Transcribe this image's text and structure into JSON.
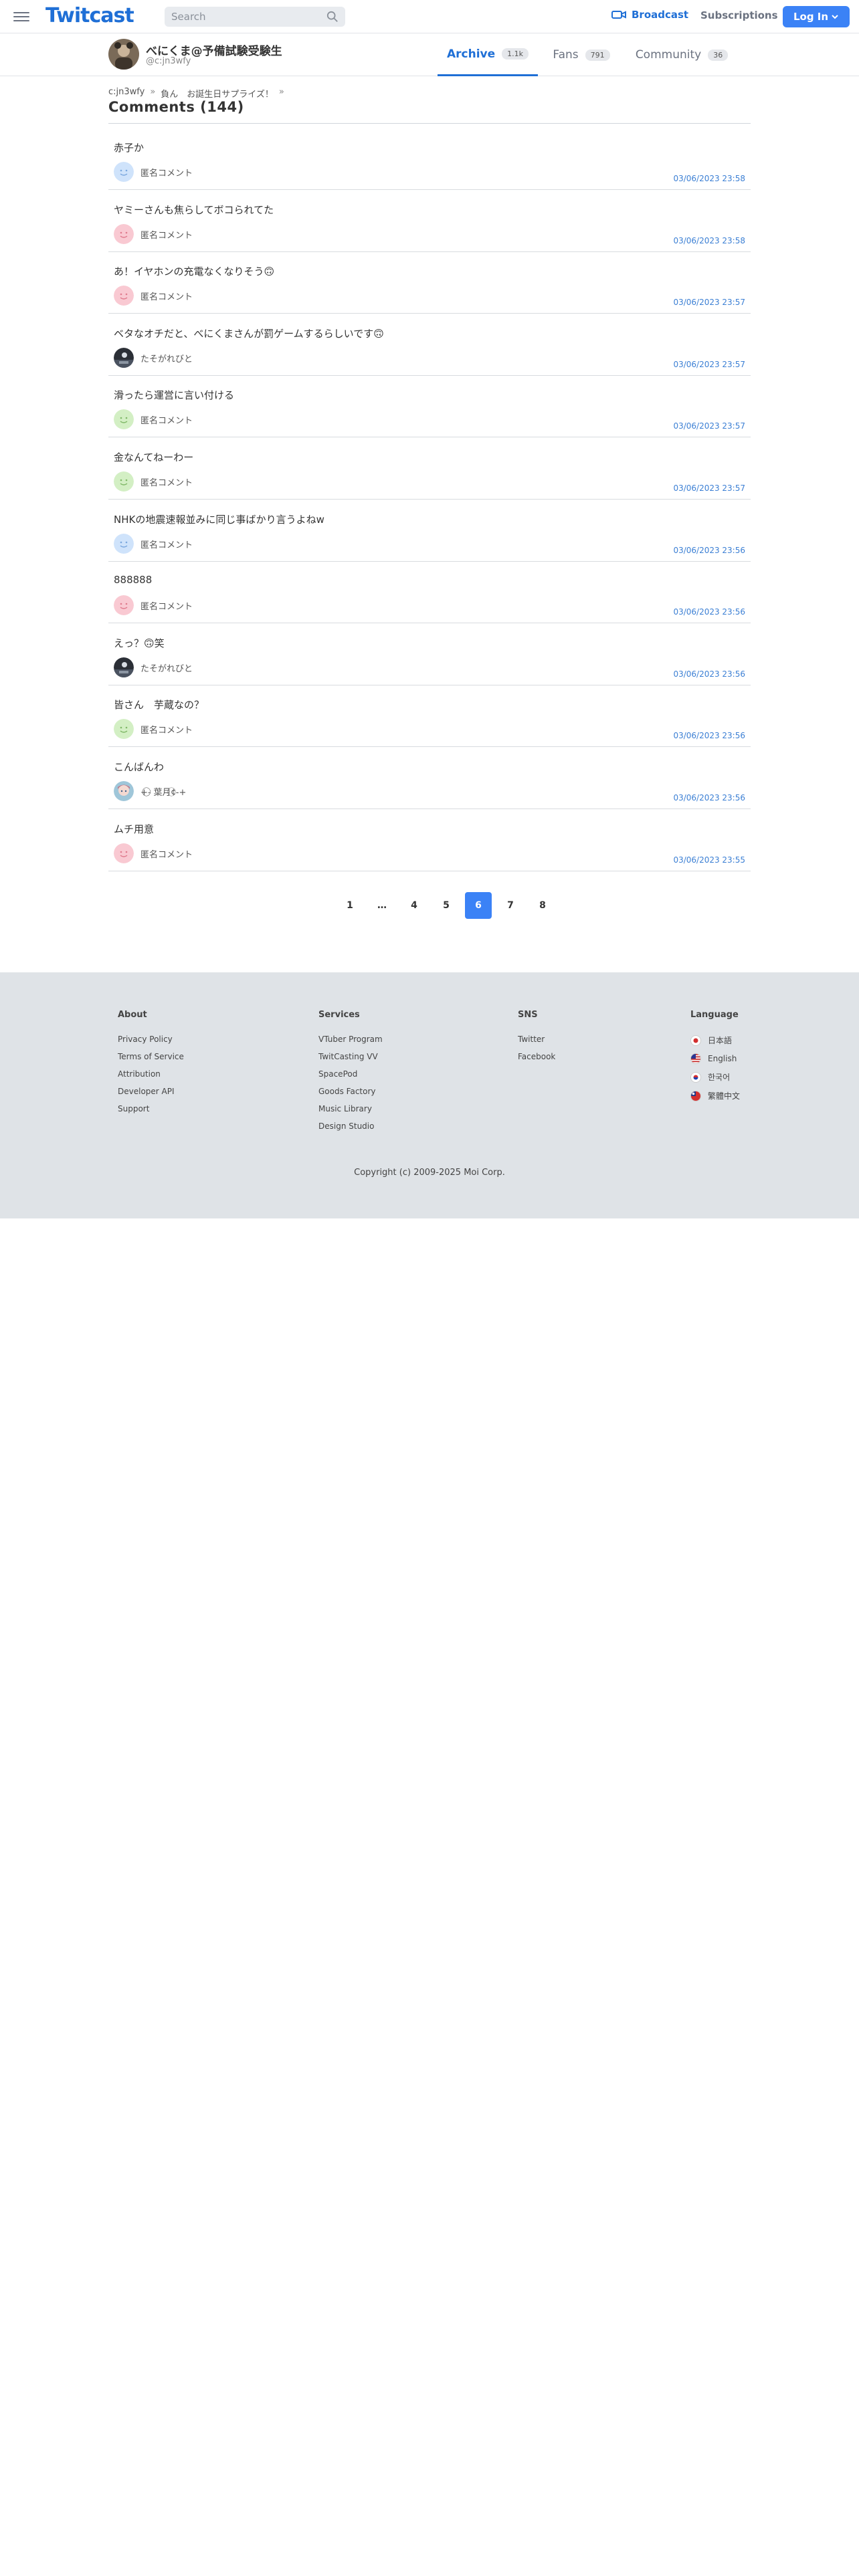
{
  "header": {
    "logo": "Twitcast",
    "search_placeholder": "Search",
    "broadcast_label": "Broadcast",
    "subscriptions_label": "Subscriptions",
    "login_label": "Log In"
  },
  "profile": {
    "name": "べにくま@予備試験受験生",
    "id": "@c:jn3wfy",
    "tabs": [
      {
        "label": "Archive",
        "count": "1.1k"
      },
      {
        "label": "Fans",
        "count": "791"
      },
      {
        "label": "Community",
        "count": "36"
      }
    ]
  },
  "breadcrumb": {
    "item0": "c:jn3wfy",
    "item1": "負ん　お誕生日サプライズ！",
    "sep": "»"
  },
  "page_title": "Comments (144)",
  "comments": [
    {
      "text": "赤子か",
      "user": "匿名コメント",
      "time": "03/06/2023 23:58",
      "avatar": "anon-blue"
    },
    {
      "text": "ヤミーさんも焦らしてボコられてた",
      "user": "匿名コメント",
      "time": "03/06/2023 23:58",
      "avatar": "anon-pink"
    },
    {
      "text": "あ！イヤホンの充電なくなりそう🙃",
      "user": "匿名コメント",
      "time": "03/06/2023 23:57",
      "avatar": "anon-pink"
    },
    {
      "text": "ベタなオチだと、べにくまさんが罰ゲームするらしいです🙃",
      "user": "たそがれびと",
      "time": "03/06/2023 23:57",
      "avatar": "photo-dark"
    },
    {
      "text": "滑ったら運営に言い付ける",
      "user": "匿名コメント",
      "time": "03/06/2023 23:57",
      "avatar": "anon-green"
    },
    {
      "text": "金なんてねーわー",
      "user": "匿名コメント",
      "time": "03/06/2023 23:57",
      "avatar": "anon-green"
    },
    {
      "text": "NHKの地震速報並みに同じ事ばかり言うよねw",
      "user": "匿名コメント",
      "time": "03/06/2023 23:56",
      "avatar": "anon-blue"
    },
    {
      "text": "888888",
      "user": "匿名コメント",
      "time": "03/06/2023 23:56",
      "avatar": "anon-pink"
    },
    {
      "text": "えっ？🙃笑",
      "user": "たそがれびと",
      "time": "03/06/2023 23:56",
      "avatar": "photo-dark"
    },
    {
      "text": "皆さん　芋蔵なの？",
      "user": "匿名コメント",
      "time": "03/06/2023 23:56",
      "avatar": "anon-green"
    },
    {
      "text": "こんばんわ",
      "user": "+-⃝⃝ 葉月¢⃝-+",
      "time": "03/06/2023 23:56",
      "avatar": "photo-anime"
    },
    {
      "text": "ムチ用意",
      "user": "匿名コメント",
      "time": "03/06/2023 23:55",
      "avatar": "anon-pink"
    }
  ],
  "pagination": {
    "pages": [
      "1",
      "…",
      "4",
      "5",
      "6",
      "7",
      "8"
    ],
    "current": "6"
  },
  "footer": {
    "about": {
      "title": "About",
      "links": [
        "Privacy Policy",
        "Terms of Service",
        "Attribution",
        "Developer API",
        "Support"
      ]
    },
    "services": {
      "title": "Services",
      "links": [
        "VTuber Program",
        "TwitCasting VV",
        "SpacePod",
        "Goods Factory",
        "Music Library",
        "Design Studio"
      ]
    },
    "sns": {
      "title": "SNS",
      "links": [
        "Twitter",
        "Facebook"
      ]
    },
    "language": {
      "title": "Language",
      "links": [
        "日本語",
        "English",
        "한국어",
        "繁體中文"
      ]
    },
    "copyright": "Copyright (c) 2009-2025 Moi Corp."
  },
  "colors": {
    "brand": "#1f6fd6",
    "button": "#3b82f6",
    "timestamp": "#3b7fd4",
    "footer_bg": "#dfe3e7"
  }
}
